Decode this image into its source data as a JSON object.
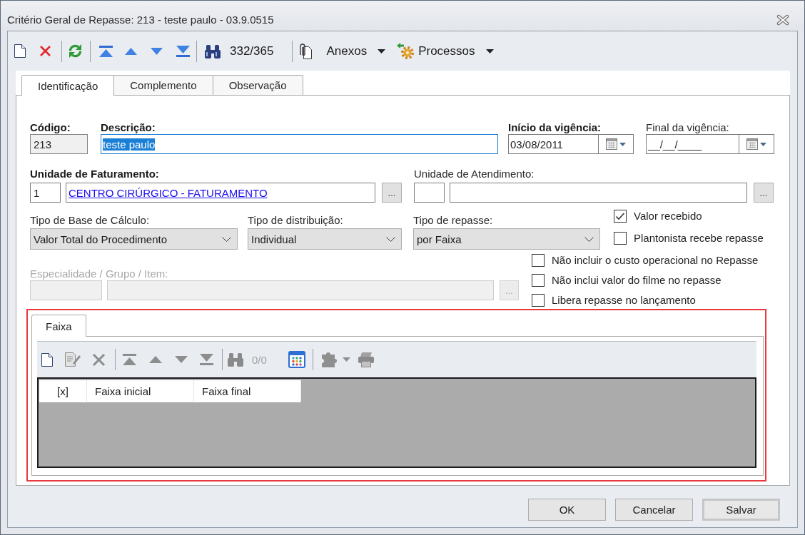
{
  "window": {
    "title": "Critério Geral de Repasse: 213 - teste paulo - 03.9.0515"
  },
  "toolbar": {
    "record_counter": {
      "text": "332/365",
      "disabled": false
    },
    "menus": [
      {
        "label": "Anexos",
        "kind": "attachments"
      },
      {
        "label": "Processos",
        "kind": "processes"
      }
    ]
  },
  "tabs": [
    {
      "label": "Identificação",
      "selected": true
    },
    {
      "label": "Complemento",
      "selected": false
    },
    {
      "label": "Observação",
      "selected": false
    }
  ],
  "form": {
    "codigo": {
      "label": "Código:",
      "required": true,
      "value": "213",
      "read_only": true
    },
    "descricao": {
      "label": "Descrição:",
      "required": true,
      "value": "teste paulo",
      "focused": true
    },
    "inicio_vigencia": {
      "label": "Início da vigência:",
      "required": true,
      "value": "03/08/2011"
    },
    "final_vigencia": {
      "label": "Final da vigência:",
      "required": false,
      "value": "__/__/____"
    },
    "unidade_faturamento": {
      "label": "Unidade de Faturamento:",
      "required": true,
      "code": "1",
      "name": "CENTRO CIRÚRGICO - FATURAMENTO",
      "browse": "..."
    },
    "unidade_atendimento": {
      "label": "Unidade de Atendimento:",
      "required": false,
      "browse": "..."
    },
    "tipo_base_calculo": {
      "label": "Tipo de Base de Cálculo:",
      "required": false,
      "value": "Valor Total do Procedimento"
    },
    "tipo_distribuicao": {
      "label": "Tipo de distribuição:",
      "required": false,
      "value": "Individual"
    },
    "tipo_repasse": {
      "label": "Tipo de repasse:",
      "required": false,
      "value": "por Faixa"
    },
    "checkboxes_right": [
      {
        "label": "Valor recebido",
        "checked": true
      },
      {
        "label": "Plantonista recebe repasse",
        "checked": false
      }
    ],
    "especialidade": {
      "label": "Especialidade / Grupo / Item:",
      "required": false,
      "disabled": true,
      "browse": "..."
    },
    "checkboxes_lower": [
      {
        "label": "Não incluir o custo operacional no Repasse",
        "checked": false
      },
      {
        "label": "Não inclui valor do filme no repasse",
        "checked": false
      },
      {
        "label": "Libera repasse no lançamento",
        "checked": false
      }
    ]
  },
  "faixa_panel": {
    "highlighted": true,
    "tabs": [
      {
        "label": "Faixa",
        "selected": true
      }
    ],
    "record_counter": {
      "text": "0/0",
      "disabled": true
    },
    "table": {
      "columns": [
        "[x]",
        "Faixa inicial",
        "Faixa final"
      ]
    }
  },
  "buttons": [
    {
      "label": "OK",
      "default": false
    },
    {
      "label": "Cancelar",
      "default": false
    },
    {
      "label": "Salvar",
      "default": true
    }
  ]
}
